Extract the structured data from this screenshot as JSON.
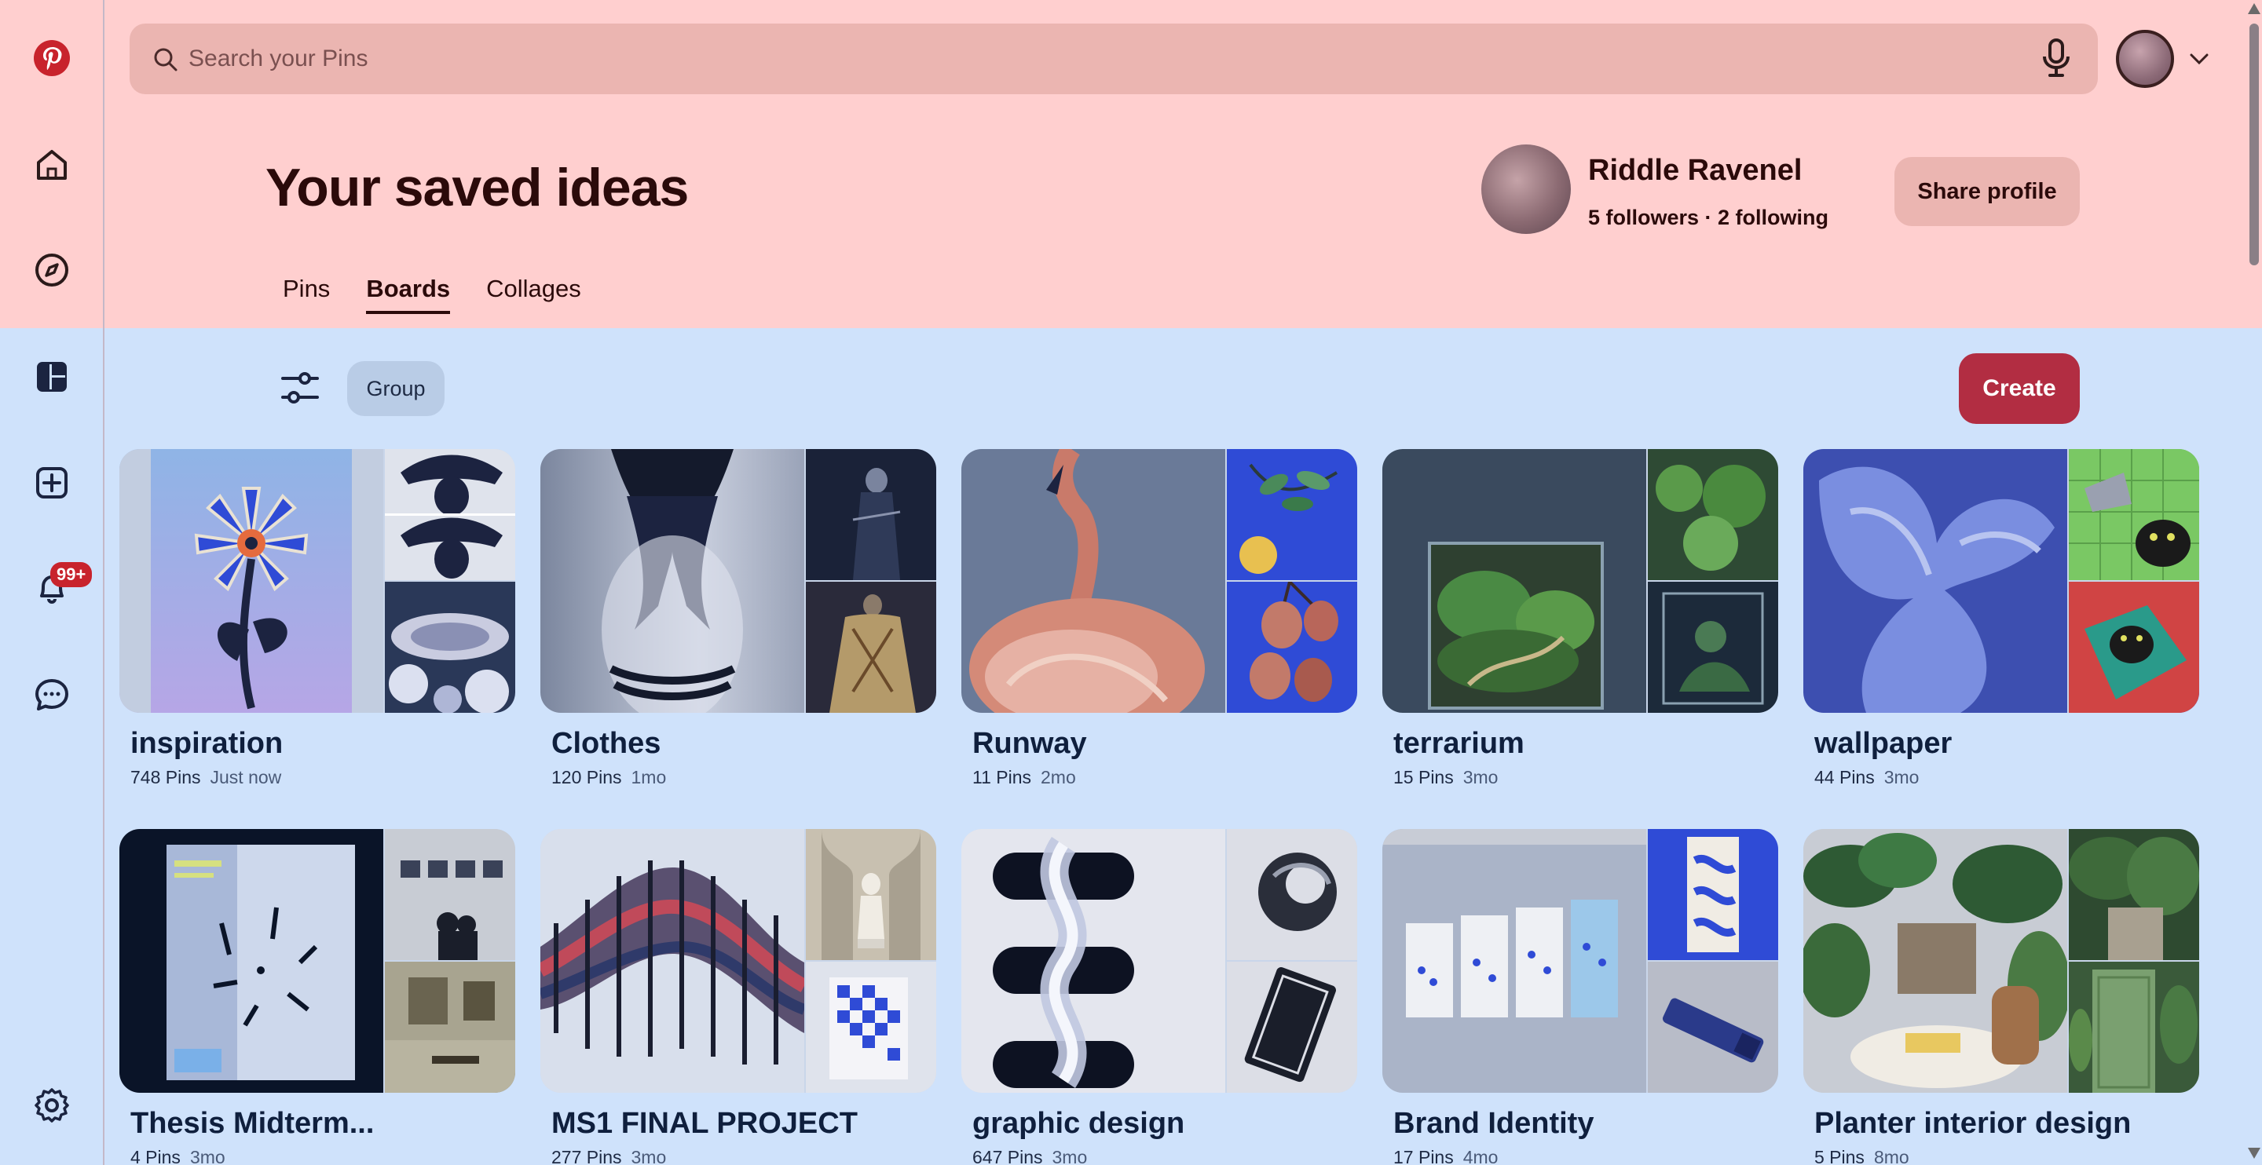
{
  "sidebar": {
    "items": [
      {
        "name": "pinterest-logo-icon"
      },
      {
        "name": "home-icon"
      },
      {
        "name": "explore-icon"
      },
      {
        "name": "boards-icon"
      },
      {
        "name": "create-icon"
      },
      {
        "name": "notifications-icon"
      },
      {
        "name": "messages-icon"
      },
      {
        "name": "settings-icon"
      }
    ],
    "notification_badge": "99+"
  },
  "search": {
    "placeholder": "Search your Pins"
  },
  "header": {
    "title": "Your saved ideas",
    "tabs": [
      {
        "label": "Pins",
        "active": false
      },
      {
        "label": "Boards",
        "active": true
      },
      {
        "label": "Collages",
        "active": false
      }
    ]
  },
  "profile": {
    "name": "Riddle Ravenel",
    "stats": "5 followers · 2 following",
    "share_label": "Share profile"
  },
  "toolbar": {
    "group_label": "Group",
    "create_label": "Create"
  },
  "boards": [
    {
      "title": "inspiration",
      "pins": "748 Pins",
      "time": "Just now"
    },
    {
      "title": "Clothes",
      "pins": "120 Pins",
      "time": "1mo"
    },
    {
      "title": "Runway",
      "pins": "11 Pins",
      "time": "2mo"
    },
    {
      "title": "terrarium",
      "pins": "15 Pins",
      "time": "3mo"
    },
    {
      "title": "wallpaper",
      "pins": "44 Pins",
      "time": "3mo"
    },
    {
      "title": "Thesis Midterm...",
      "pins": "4 Pins",
      "time": "3mo"
    },
    {
      "title": "MS1 FINAL PROJECT",
      "pins": "277 Pins",
      "time": "3mo"
    },
    {
      "title": "graphic design",
      "pins": "647 Pins",
      "time": "3mo"
    },
    {
      "title": "Brand Identity",
      "pins": "17 Pins",
      "time": "4mo"
    },
    {
      "title": "Planter interior design",
      "pins": "5 Pins",
      "time": "8mo"
    }
  ],
  "colors": {
    "header_bg": "#ffcfcf",
    "content_bg": "#cfe2fb",
    "create_button": "#b22d42",
    "badge": "#c8232c"
  }
}
